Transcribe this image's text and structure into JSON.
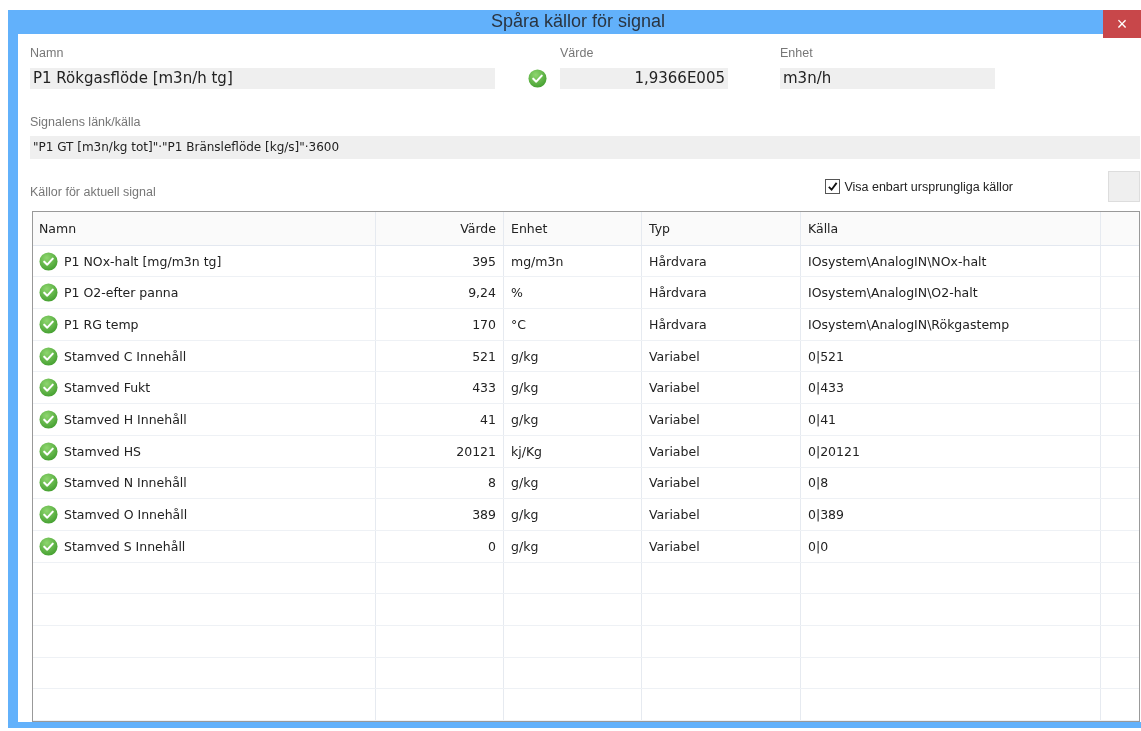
{
  "window": {
    "title": "Spåra källor för signal",
    "close": "×"
  },
  "fields": {
    "name_label": "Namn",
    "name_value": "P1 Rökgasflöde [m3n/h tg]",
    "value_label": "Värde",
    "value_ok": true,
    "value": "1,9366E005",
    "unit_label": "Enhet",
    "unit": "m3n/h",
    "link_label": "Signalens länk/källa",
    "link": "\"P1 GT [m3n/kg tot]\"·\"P1 Bränsleflöde [kg/s]\"·3600"
  },
  "sources_label": "Källor för aktuell signal",
  "only_original": {
    "label": "Visa enbart ursprungliga källor",
    "checked": true
  },
  "table": {
    "columns": [
      "Namn",
      "Värde",
      "Enhet",
      "Typ",
      "Källa"
    ],
    "rows": [
      {
        "ok": true,
        "name": "P1 NOx-halt [mg/m3n tg]",
        "value": "395",
        "unit": "mg/m3n",
        "type": "Hårdvara",
        "source": "IOsystem\\AnalogIN\\NOx-halt"
      },
      {
        "ok": true,
        "name": "P1 O2-efter panna",
        "value": "9,24",
        "unit": "%",
        "type": "Hårdvara",
        "source": "IOsystem\\AnalogIN\\O2-halt"
      },
      {
        "ok": true,
        "name": "P1 RG temp",
        "value": "170",
        "unit": "°C",
        "type": "Hårdvara",
        "source": "IOsystem\\AnalogIN\\Rökgastemp"
      },
      {
        "ok": true,
        "name": "Stamved C Innehåll",
        "value": "521",
        "unit": "g/kg",
        "type": "Variabel",
        "source": "0|521"
      },
      {
        "ok": true,
        "name": "Stamved Fukt",
        "value": "433",
        "unit": "g/kg",
        "type": "Variabel",
        "source": "0|433"
      },
      {
        "ok": true,
        "name": "Stamved H Innehåll",
        "value": "41",
        "unit": "g/kg",
        "type": "Variabel",
        "source": "0|41"
      },
      {
        "ok": true,
        "name": "Stamved HS",
        "value": "20121",
        "unit": "kj/Kg",
        "type": "Variabel",
        "source": "0|20121"
      },
      {
        "ok": true,
        "name": "Stamved N Innehåll",
        "value": "8",
        "unit": "g/kg",
        "type": "Variabel",
        "source": "0|8"
      },
      {
        "ok": true,
        "name": "Stamved O Innehåll",
        "value": "389",
        "unit": "g/kg",
        "type": "Variabel",
        "source": "0|389"
      },
      {
        "ok": true,
        "name": "Stamved S Innehåll",
        "value": "0",
        "unit": "g/kg",
        "type": "Variabel",
        "source": "0|0"
      }
    ]
  }
}
